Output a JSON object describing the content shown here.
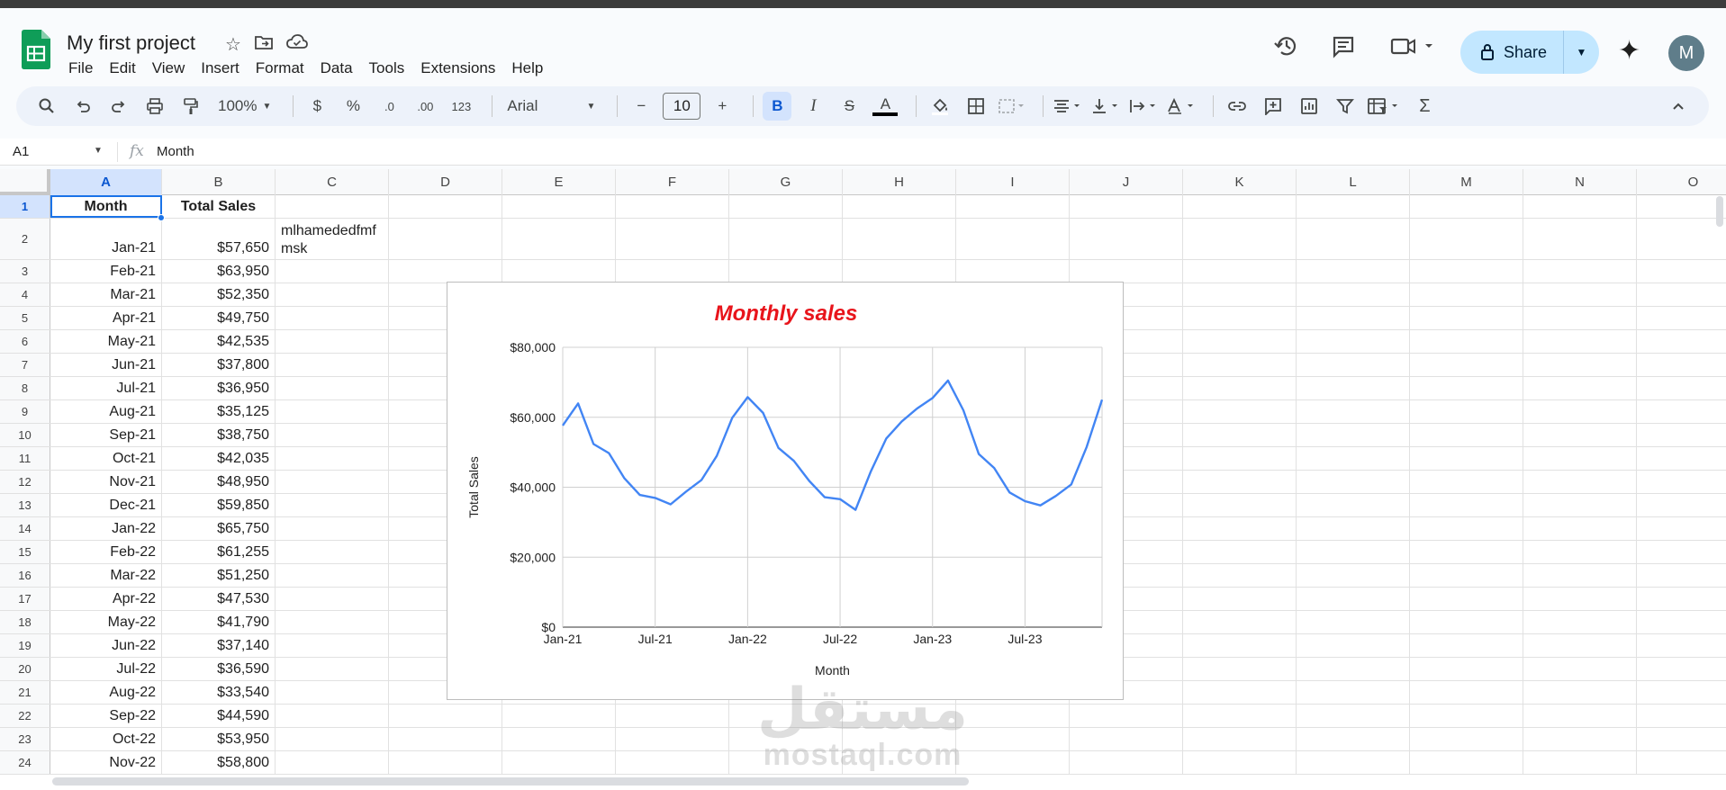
{
  "app": {
    "title": "My first project",
    "menu": [
      "File",
      "Edit",
      "View",
      "Insert",
      "Format",
      "Data",
      "Tools",
      "Extensions",
      "Help"
    ],
    "share_label": "Share",
    "avatar_letter": "M"
  },
  "toolbar": {
    "zoom": "100%",
    "currency": "$",
    "percent": "%",
    "dec_decrease": ".0",
    "dec_increase": ".00",
    "number_format": "123",
    "font": "Arial",
    "font_size": "10",
    "bold": "B",
    "italic": "I",
    "strike": "S",
    "text_color": "A",
    "minus": "−",
    "plus": "+",
    "sigma": "Σ"
  },
  "formula_bar": {
    "cell_ref": "A1",
    "fx": "fx",
    "content": "Month"
  },
  "columns": [
    "A",
    "B",
    "C",
    "D",
    "E",
    "F",
    "G",
    "H",
    "I",
    "J",
    "K",
    "L",
    "M",
    "N",
    "O"
  ],
  "rows": [
    {
      "num": "1",
      "a": "Month",
      "b": "Total Sales",
      "c": ""
    },
    {
      "num": "2",
      "a": "Jan-21",
      "b": "$57,650",
      "c": "mlhamededfmfmsk"
    },
    {
      "num": "3",
      "a": "Feb-21",
      "b": "$63,950",
      "c": ""
    },
    {
      "num": "4",
      "a": "Mar-21",
      "b": "$52,350",
      "c": ""
    },
    {
      "num": "5",
      "a": "Apr-21",
      "b": "$49,750",
      "c": ""
    },
    {
      "num": "6",
      "a": "May-21",
      "b": "$42,535",
      "c": ""
    },
    {
      "num": "7",
      "a": "Jun-21",
      "b": "$37,800",
      "c": ""
    },
    {
      "num": "8",
      "a": "Jul-21",
      "b": "$36,950",
      "c": ""
    },
    {
      "num": "9",
      "a": "Aug-21",
      "b": "$35,125",
      "c": ""
    },
    {
      "num": "10",
      "a": "Sep-21",
      "b": "$38,750",
      "c": ""
    },
    {
      "num": "11",
      "a": "Oct-21",
      "b": "$42,035",
      "c": ""
    },
    {
      "num": "12",
      "a": "Nov-21",
      "b": "$48,950",
      "c": ""
    },
    {
      "num": "13",
      "a": "Dec-21",
      "b": "$59,850",
      "c": ""
    },
    {
      "num": "14",
      "a": "Jan-22",
      "b": "$65,750",
      "c": ""
    },
    {
      "num": "15",
      "a": "Feb-22",
      "b": "$61,255",
      "c": ""
    },
    {
      "num": "16",
      "a": "Mar-22",
      "b": "$51,250",
      "c": ""
    },
    {
      "num": "17",
      "a": "Apr-22",
      "b": "$47,530",
      "c": ""
    },
    {
      "num": "18",
      "a": "May-22",
      "b": "$41,790",
      "c": ""
    },
    {
      "num": "19",
      "a": "Jun-22",
      "b": "$37,140",
      "c": ""
    },
    {
      "num": "20",
      "a": "Jul-22",
      "b": "$36,590",
      "c": ""
    },
    {
      "num": "21",
      "a": "Aug-22",
      "b": "$33,540",
      "c": ""
    },
    {
      "num": "22",
      "a": "Sep-22",
      "b": "$44,590",
      "c": ""
    },
    {
      "num": "23",
      "a": "Oct-22",
      "b": "$53,950",
      "c": ""
    },
    {
      "num": "24",
      "a": "Nov-22",
      "b": "$58,800",
      "c": ""
    }
  ],
  "chart_data": {
    "type": "line",
    "title": "Monthly sales",
    "title_color": "#e8141b",
    "line_color": "#4285f4",
    "xlabel": "Month",
    "ylabel": "Total Sales",
    "ylim": [
      0,
      80000
    ],
    "y_ticks": [
      0,
      20000,
      40000,
      60000,
      80000
    ],
    "y_tick_labels": [
      "$0",
      "$20,000",
      "$40,000",
      "$60,000",
      "$80,000"
    ],
    "x_tick_labels": [
      "Jan-21",
      "Jul-21",
      "Jan-22",
      "Jul-22",
      "Jan-23",
      "Jul-23"
    ],
    "grid": true,
    "legend": "none",
    "series": [
      {
        "values": [
          57650,
          63950,
          52350,
          49750,
          42535,
          37800,
          36950,
          35125,
          38750,
          42035,
          48950,
          59850,
          65750,
          61255,
          51250,
          47530,
          41790,
          37140,
          36590,
          33540,
          44590,
          53950,
          58800,
          62500,
          65500,
          70500,
          62000,
          49500,
          45500,
          38500,
          36000,
          34800,
          37500,
          40800,
          51500,
          65000
        ]
      }
    ]
  },
  "watermark": {
    "arabic": "مستقل",
    "latin": "mostaql.com"
  }
}
